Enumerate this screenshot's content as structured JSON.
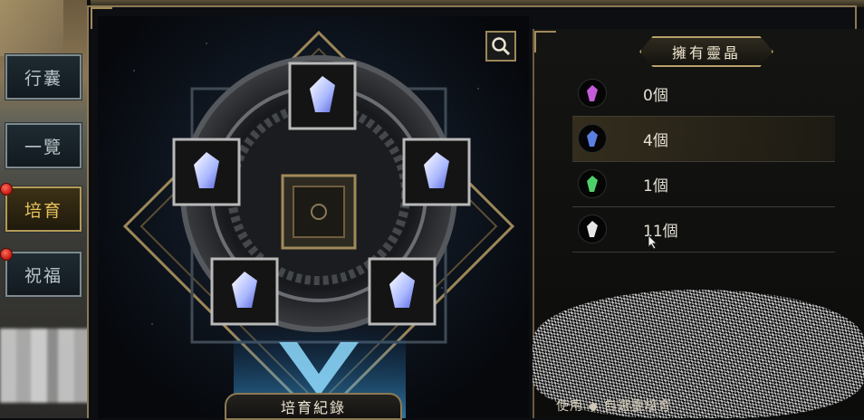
{
  "side_tabs": [
    {
      "label": "行囊",
      "active": false,
      "badge": false
    },
    {
      "label": "一覽",
      "active": false,
      "badge": false
    },
    {
      "label": "培育",
      "active": true,
      "badge": true
    },
    {
      "label": "祝福",
      "active": false,
      "badge": true
    }
  ],
  "main": {
    "record_button": "培育紀錄",
    "slots": [
      {
        "name": "top",
        "gem": "crystal-icon"
      },
      {
        "name": "upper-left",
        "gem": "crystal-icon"
      },
      {
        "name": "upper-right",
        "gem": "crystal-icon"
      },
      {
        "name": "lower-left",
        "gem": "crystal-icon"
      },
      {
        "name": "lower-right",
        "gem": "crystal-icon"
      }
    ]
  },
  "right_panel": {
    "title": "擁有靈晶",
    "crystals": [
      {
        "color": "#c45bd9",
        "count": "0個"
      },
      {
        "color": "#5b7fe0",
        "count": "4個"
      },
      {
        "color": "#4fcf6a",
        "count": "1個"
      },
      {
        "color": "#e6e6e6",
        "count": "11個"
      }
    ],
    "footer_text": "使用 ◆ 自選靈培育"
  },
  "colors": {
    "gold": "#b59a55",
    "active_tab_text": "#e8c25c"
  }
}
